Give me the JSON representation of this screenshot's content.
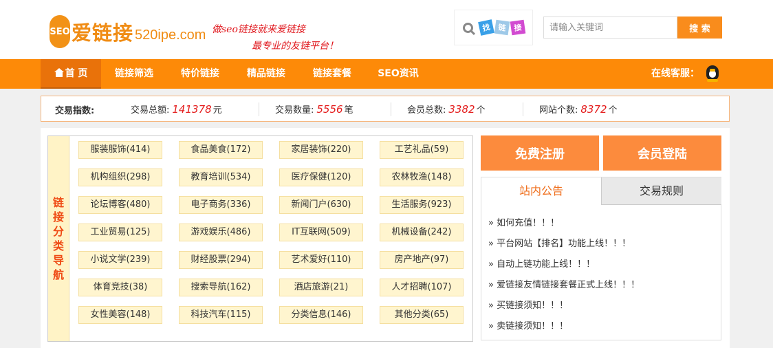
{
  "logo": {
    "badge": "SEO",
    "name": "爱链接",
    "domain": "520ipe.com"
  },
  "slogan": {
    "line1": "做seo链接就来爱链接",
    "line2": "最专业的友链平台！"
  },
  "find": {
    "tiles": [
      "找",
      "链",
      "接"
    ]
  },
  "search": {
    "placeholder": "请输入关键词",
    "button": "搜 索"
  },
  "nav": {
    "items": [
      "首 页",
      "链接筛选",
      "特价链接",
      "精品链接",
      "链接套餐",
      "SEO资讯"
    ],
    "service": "在线客服："
  },
  "stats": {
    "label": "交易指数:",
    "items": [
      {
        "label": "交易总额:",
        "value": "141378",
        "unit": "元"
      },
      {
        "label": "交易数量:",
        "value": "5556",
        "unit": "笔"
      },
      {
        "label": "会员总数:",
        "value": "3382",
        "unit": "个"
      },
      {
        "label": "网站个数:",
        "value": "8372",
        "unit": "个"
      }
    ]
  },
  "categories": {
    "side_label": "链接分类导航",
    "items": [
      "服装服饰(414)",
      "食品美食(172)",
      "家居装饰(220)",
      "工艺礼品(59)",
      "机构组织(298)",
      "教育培训(534)",
      "医疗保健(120)",
      "农林牧渔(148)",
      "论坛博客(480)",
      "电子商务(336)",
      "新闻门户(630)",
      "生活服务(923)",
      "工业贸易(125)",
      "游戏娱乐(486)",
      "IT互联网(509)",
      "机械设备(242)",
      "小说文学(239)",
      "财经股票(294)",
      "艺术爱好(110)",
      "房产地产(97)",
      "体育竞技(38)",
      "搜索导航(162)",
      "酒店旅游(21)",
      "人才招聘(107)",
      "女性美容(148)",
      "科技汽车(115)",
      "分类信息(146)",
      "其他分类(65)"
    ]
  },
  "actions": {
    "register": "免费注册",
    "login": "会员登陆"
  },
  "notice": {
    "tabs": [
      "站内公告",
      "交易规则"
    ],
    "items": [
      "» 如何充值！！！",
      "» 平台网站【排名】功能上线！！！",
      "» 自动上链功能上线！！！",
      "» 爱链接友情链接套餐正式上线！！！",
      "» 买链接须知！！！",
      "» 卖链接须知！！！"
    ]
  },
  "colors": {
    "brand": "#fd8a08",
    "accent": "#fc8b3d",
    "number": "#e41c1c"
  }
}
